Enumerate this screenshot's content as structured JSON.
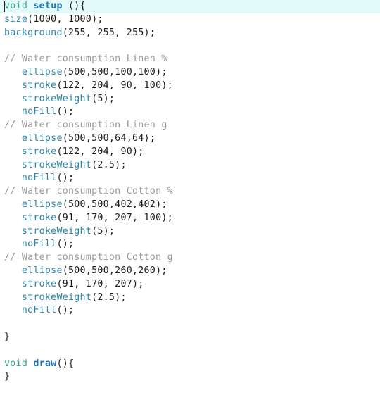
{
  "editor": {
    "name": "processing-code-editor",
    "language": "Processing / Java",
    "background_color": "#ffffff",
    "current_line_highlight_color": "#e2fbfa",
    "caret_line": 1,
    "colors": {
      "keyword": "#35a38b",
      "function_name": "#1a6fb5",
      "builtin_function": "#2d85a8",
      "comment": "#9a9a9a",
      "plain": "#1a1a1a"
    },
    "lines": [
      {
        "n": 1,
        "current": true,
        "indent": 0,
        "tokens": [
          {
            "t": "void",
            "c": "kw"
          },
          {
            "t": " ",
            "c": "punc"
          },
          {
            "t": "setup",
            "c": "fnname"
          },
          {
            "t": " (){",
            "c": "punc"
          }
        ]
      },
      {
        "n": 2,
        "current": false,
        "indent": 0,
        "tokens": [
          {
            "t": "size",
            "c": "fn"
          },
          {
            "t": "(1000, 1000);",
            "c": "punc"
          }
        ]
      },
      {
        "n": 3,
        "current": false,
        "indent": 0,
        "tokens": [
          {
            "t": "background",
            "c": "fn"
          },
          {
            "t": "(255, 255, 255);",
            "c": "punc"
          }
        ]
      },
      {
        "n": 4,
        "current": false,
        "indent": 0,
        "tokens": []
      },
      {
        "n": 5,
        "current": false,
        "indent": 0,
        "tokens": [
          {
            "t": "// Water consumption Linen %",
            "c": "cmt"
          }
        ]
      },
      {
        "n": 6,
        "current": false,
        "indent": 3,
        "tokens": [
          {
            "t": "ellipse",
            "c": "fn"
          },
          {
            "t": "(500,500,100,100);",
            "c": "punc"
          }
        ]
      },
      {
        "n": 7,
        "current": false,
        "indent": 3,
        "tokens": [
          {
            "t": "stroke",
            "c": "fn"
          },
          {
            "t": "(122, 204, 90, 100);",
            "c": "punc"
          }
        ]
      },
      {
        "n": 8,
        "current": false,
        "indent": 3,
        "tokens": [
          {
            "t": "strokeWeight",
            "c": "fn"
          },
          {
            "t": "(5);",
            "c": "punc"
          }
        ]
      },
      {
        "n": 9,
        "current": false,
        "indent": 3,
        "tokens": [
          {
            "t": "noFill",
            "c": "fn"
          },
          {
            "t": "();",
            "c": "punc"
          }
        ]
      },
      {
        "n": 10,
        "current": false,
        "indent": 0,
        "tokens": [
          {
            "t": "// Water consumption Linen g",
            "c": "cmt"
          }
        ]
      },
      {
        "n": 11,
        "current": false,
        "indent": 3,
        "tokens": [
          {
            "t": "ellipse",
            "c": "fn"
          },
          {
            "t": "(500,500,64,64);",
            "c": "punc"
          }
        ]
      },
      {
        "n": 12,
        "current": false,
        "indent": 3,
        "tokens": [
          {
            "t": "stroke",
            "c": "fn"
          },
          {
            "t": "(122, 204, 90);",
            "c": "punc"
          }
        ]
      },
      {
        "n": 13,
        "current": false,
        "indent": 3,
        "tokens": [
          {
            "t": "strokeWeight",
            "c": "fn"
          },
          {
            "t": "(2.5);",
            "c": "punc"
          }
        ]
      },
      {
        "n": 14,
        "current": false,
        "indent": 3,
        "tokens": [
          {
            "t": "noFill",
            "c": "fn"
          },
          {
            "t": "();",
            "c": "punc"
          }
        ]
      },
      {
        "n": 15,
        "current": false,
        "indent": 0,
        "tokens": [
          {
            "t": "// Water consumption Cotton %",
            "c": "cmt"
          }
        ]
      },
      {
        "n": 16,
        "current": false,
        "indent": 3,
        "tokens": [
          {
            "t": "ellipse",
            "c": "fn"
          },
          {
            "t": "(500,500,402,402);",
            "c": "punc"
          }
        ]
      },
      {
        "n": 17,
        "current": false,
        "indent": 3,
        "tokens": [
          {
            "t": "stroke",
            "c": "fn"
          },
          {
            "t": "(91, 170, 207, 100);",
            "c": "punc"
          }
        ]
      },
      {
        "n": 18,
        "current": false,
        "indent": 3,
        "tokens": [
          {
            "t": "strokeWeight",
            "c": "fn"
          },
          {
            "t": "(5);",
            "c": "punc"
          }
        ]
      },
      {
        "n": 19,
        "current": false,
        "indent": 3,
        "tokens": [
          {
            "t": "noFill",
            "c": "fn"
          },
          {
            "t": "();",
            "c": "punc"
          }
        ]
      },
      {
        "n": 20,
        "current": false,
        "indent": 0,
        "tokens": [
          {
            "t": "// Water consumption Cotton g",
            "c": "cmt"
          }
        ]
      },
      {
        "n": 21,
        "current": false,
        "indent": 3,
        "tokens": [
          {
            "t": "ellipse",
            "c": "fn"
          },
          {
            "t": "(500,500,260,260);",
            "c": "punc"
          }
        ]
      },
      {
        "n": 22,
        "current": false,
        "indent": 3,
        "tokens": [
          {
            "t": "stroke",
            "c": "fn"
          },
          {
            "t": "(91, 170, 207);",
            "c": "punc"
          }
        ]
      },
      {
        "n": 23,
        "current": false,
        "indent": 3,
        "tokens": [
          {
            "t": "strokeWeight",
            "c": "fn"
          },
          {
            "t": "(2.5);",
            "c": "punc"
          }
        ]
      },
      {
        "n": 24,
        "current": false,
        "indent": 3,
        "tokens": [
          {
            "t": "noFill",
            "c": "fn"
          },
          {
            "t": "();",
            "c": "punc"
          }
        ]
      },
      {
        "n": 25,
        "current": false,
        "indent": 0,
        "tokens": []
      },
      {
        "n": 26,
        "current": false,
        "indent": 0,
        "tokens": [
          {
            "t": "}",
            "c": "brace"
          }
        ]
      },
      {
        "n": 27,
        "current": false,
        "indent": 0,
        "tokens": []
      },
      {
        "n": 28,
        "current": false,
        "indent": 0,
        "tokens": [
          {
            "t": "void",
            "c": "kw"
          },
          {
            "t": " ",
            "c": "punc"
          },
          {
            "t": "draw",
            "c": "fnname"
          },
          {
            "t": "(){",
            "c": "punc"
          }
        ]
      },
      {
        "n": 29,
        "current": false,
        "indent": 0,
        "tokens": [
          {
            "t": "}",
            "c": "brace"
          }
        ]
      }
    ]
  }
}
